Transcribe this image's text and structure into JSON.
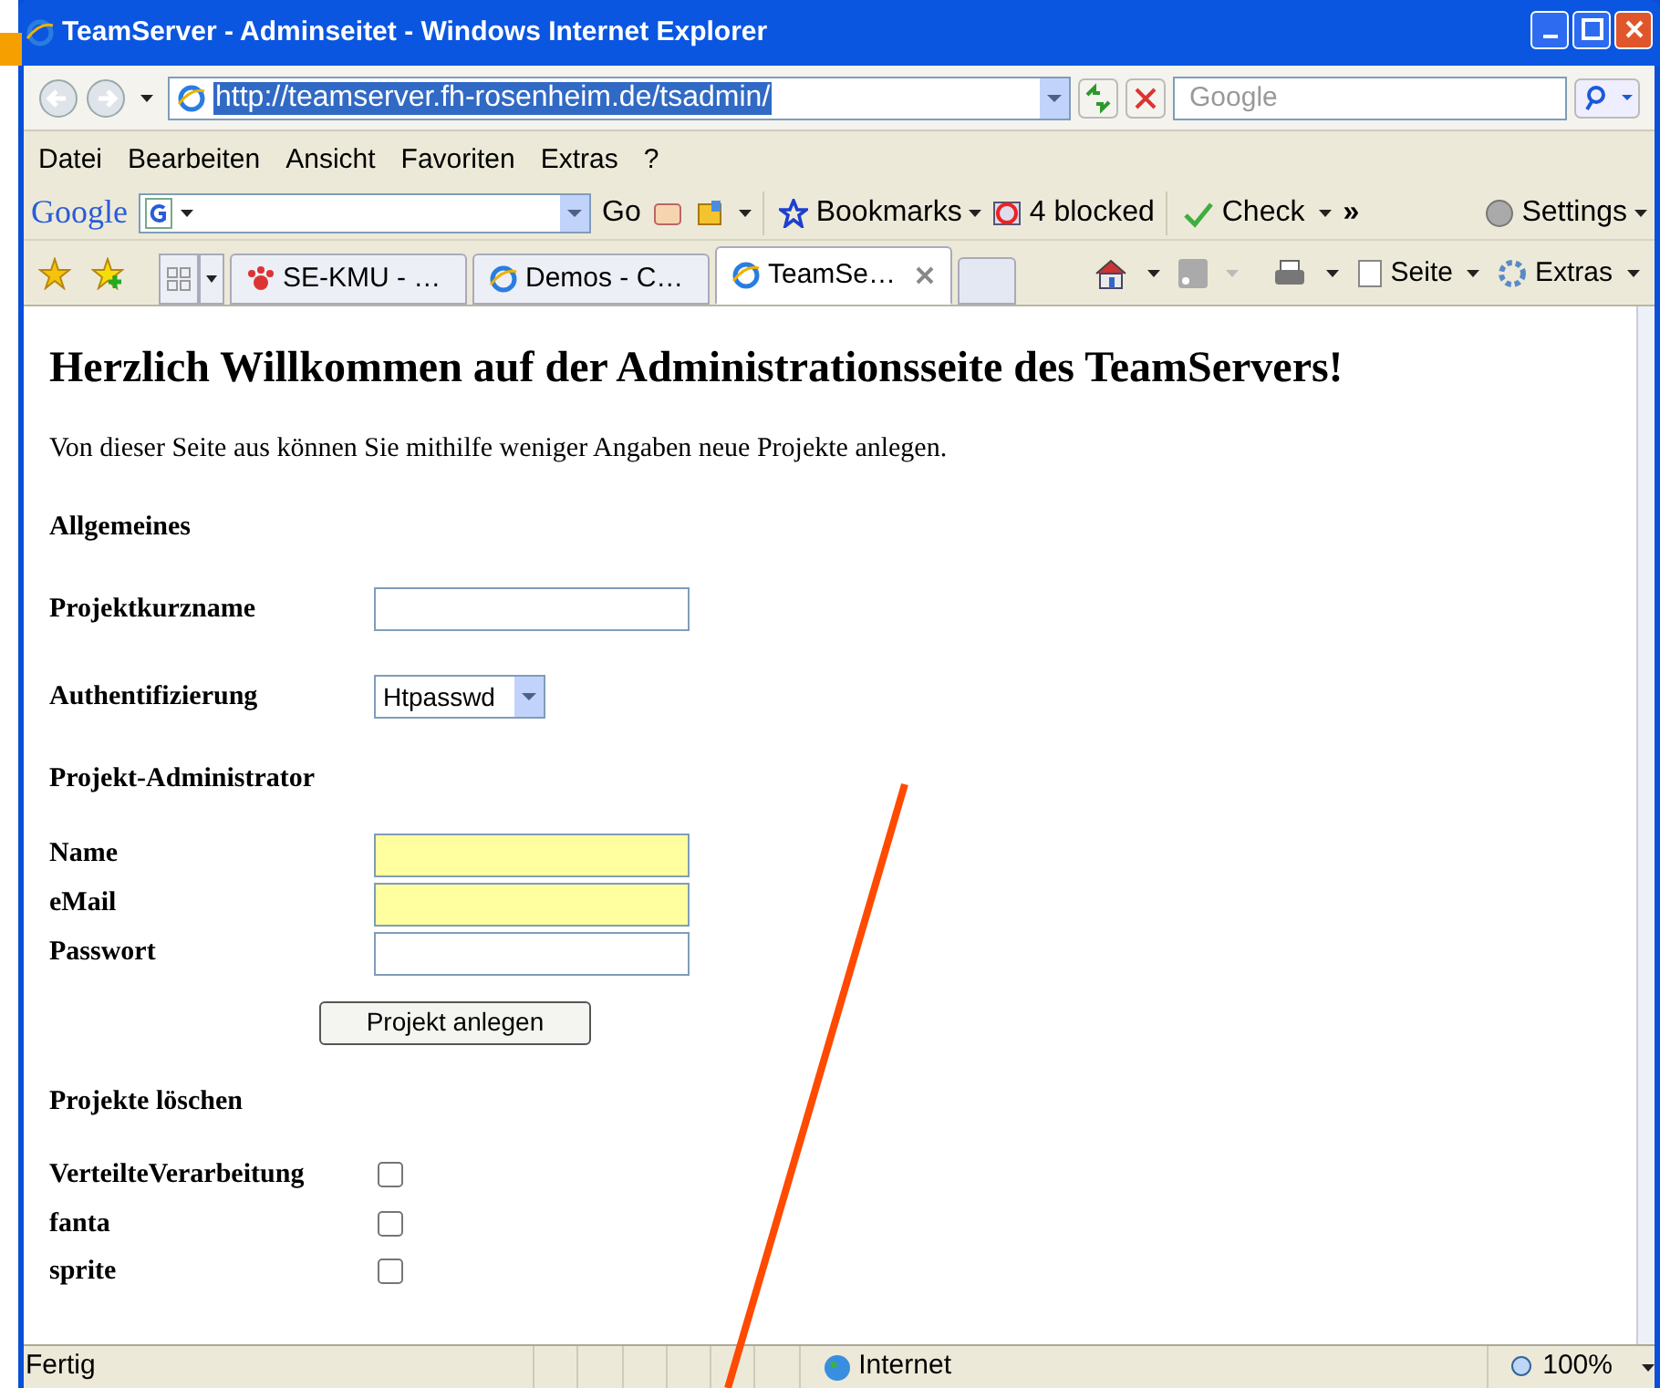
{
  "window": {
    "title": "TeamServer - Adminseitet - Windows Internet Explorer"
  },
  "address_bar": {
    "url": "http://teamserver.fh-rosenheim.de/tsadmin/",
    "search_placeholder": "Google"
  },
  "menu": [
    "Datei",
    "Bearbeiten",
    "Ansicht",
    "Favoriten",
    "Extras",
    "?"
  ],
  "google_toolbar": {
    "logo": "Google",
    "go": "Go",
    "bookmarks": "Bookmarks",
    "blocked": "4 blocked",
    "check": "Check",
    "more": "»",
    "settings": "Settings"
  },
  "tabs": [
    {
      "label": "SE-KMU - …",
      "selected": false,
      "kind": "paw"
    },
    {
      "label": "Demos - C…",
      "selected": false,
      "kind": "ie"
    },
    {
      "label": "TeamSe…",
      "selected": true,
      "kind": "ie"
    }
  ],
  "command_bar": {
    "page": "Seite",
    "tools": "Extras"
  },
  "page": {
    "heading": "Herzlich Willkommen auf der Administrationsseite des TeamServers!",
    "intro": "Von dieser Seite aus können Sie mithilfe weniger Angaben neue Projekte anlegen.",
    "general": "Allgemeines",
    "fields": [
      {
        "label": "Projektkurzname",
        "kind": "text"
      },
      {
        "label": "Authentifizierung",
        "kind": "select",
        "value": "Htpasswd"
      }
    ],
    "admin": "Projekt-Administrator",
    "admin_fields": [
      {
        "label": "Name",
        "highlighted": true
      },
      {
        "label": "eMail",
        "highlighted": true
      },
      {
        "label": "Passwort",
        "highlighted": false
      }
    ],
    "submit": "Projekt anlegen",
    "delete": "Projekte löschen",
    "projects": [
      {
        "name": "VerteilteVerarbeitung",
        "checked": false
      },
      {
        "name": "fanta",
        "checked": false
      },
      {
        "name": "sprite",
        "checked": false
      }
    ]
  },
  "status_bar": {
    "text": "Fertig",
    "zone": "Internet",
    "zoom": "100%"
  }
}
